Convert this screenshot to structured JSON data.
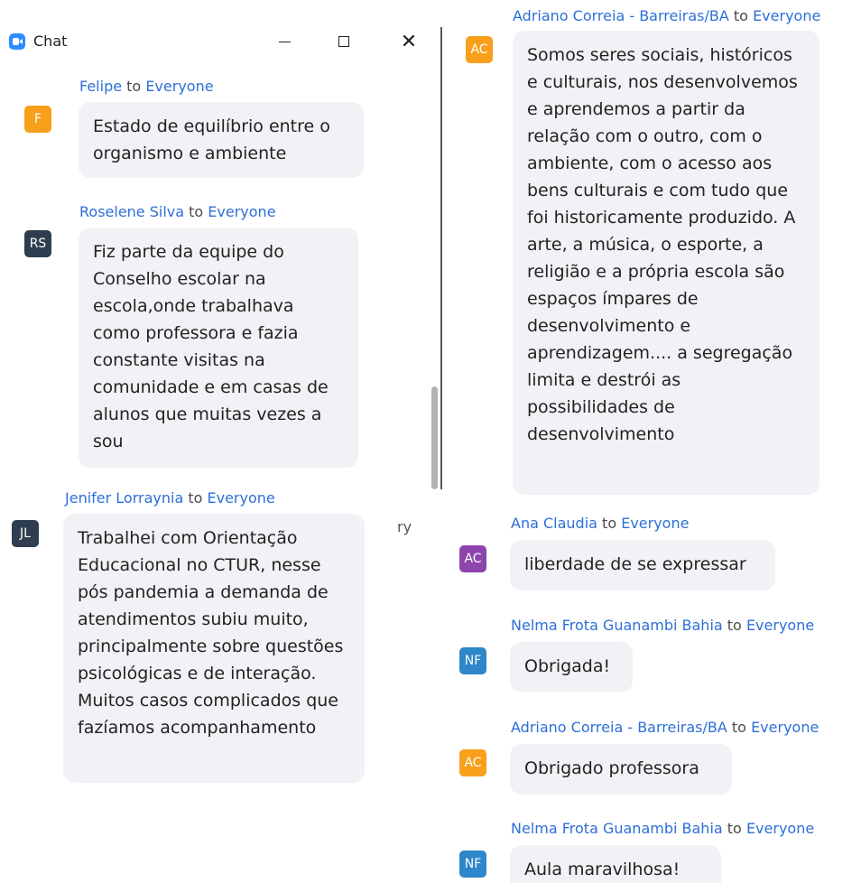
{
  "window": {
    "title": "Chat",
    "minimize_icon": "minimize-icon",
    "maximize_icon": "maximize-icon",
    "close_icon": "close-icon",
    "close_symbol": "✕"
  },
  "colors": {
    "sender_name": "#2d6fd8",
    "bubble_bg": "#f2f2f6",
    "orange": "#f89f1b",
    "navy": "#2e3d4f",
    "purple": "#8e44ad",
    "blue": "#2f86c8"
  },
  "to_word": "to",
  "recipient": "Everyone",
  "stray_text": "ry",
  "left_messages": [
    {
      "sender": "Felipe",
      "initials": "F",
      "text": "Estado de equilíbrio entre o organismo e ambiente"
    },
    {
      "sender": "Roselene Silva",
      "initials": "RS",
      "text": "Fiz parte da equipe do Conselho escolar na escola,onde trabalhava como professora e fazia constante visitas na comunidade e em casas de alunos que muitas vezes a sou"
    },
    {
      "sender": "Jenifer Lorraynia",
      "initials": "JL",
      "text": "Trabalhei com Orientação Educacional no CTUR, nesse pós pandemia a demanda de atendimentos subiu muito, principalmente sobre questões psicológicas e de interação.  Muitos casos complicados que fazíamos acompanhamento"
    }
  ],
  "right_messages": [
    {
      "sender": "Adriano Correia - Barreiras/BA",
      "initials": "AC",
      "text": "Somos seres sociais, históricos e culturais, nos desenvolvemos e aprendemos a partir da relação com o outro, com o ambiente, com o acesso aos bens culturais e com tudo que foi historicamente produzido. A arte, a música, o esporte, a religião e a própria escola são espaços ímpares de desenvolvimento e aprendizagem.... a segregação limita e destrói as possibilidades de desenvolvimento"
    },
    {
      "sender": "Ana Claudia",
      "initials": "AC",
      "text": "liberdade de se expressar"
    },
    {
      "sender": "Nelma Frota Guanambi Bahia",
      "initials": "NF",
      "text": "Obrigada!"
    },
    {
      "sender": "Adriano Correia - Barreiras/BA",
      "initials": "AC",
      "text": "Obrigado professora"
    },
    {
      "sender": "Nelma Frota Guanambi Bahia",
      "initials": "NF",
      "text": "Aula maravilhosa!"
    }
  ]
}
